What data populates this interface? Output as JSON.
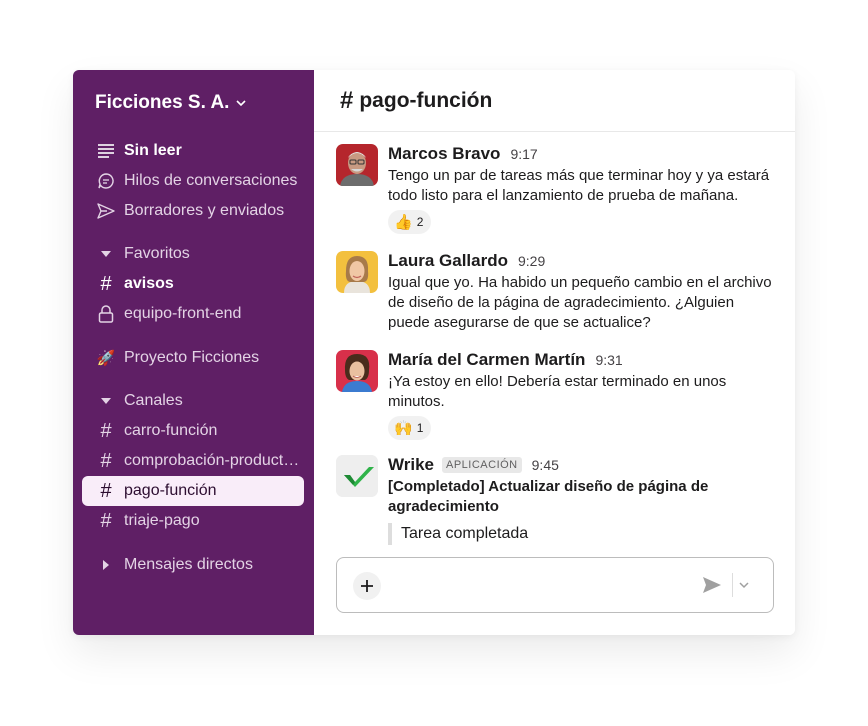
{
  "workspace": {
    "name": "Ficciones S. A."
  },
  "sidebar": {
    "top_items": [
      {
        "label": "Sin leer",
        "icon": "unread-icon"
      },
      {
        "label": "Hilos de conversaciones",
        "icon": "threads-icon"
      },
      {
        "label": "Borradores y enviados",
        "icon": "send-icon"
      }
    ],
    "favorites_section": "Favoritos",
    "favorites": [
      {
        "label": "avisos",
        "icon": "hash-icon"
      },
      {
        "label": "equipo-front-end",
        "icon": "lock-icon"
      }
    ],
    "project": {
      "label": "Proyecto Ficciones",
      "icon": "rocket-icon"
    },
    "channels_section": "Canales",
    "channels": [
      {
        "label": "carro-función"
      },
      {
        "label": "comprobación-product…"
      },
      {
        "label": "pago-función"
      },
      {
        "label": "triaje-pago"
      }
    ],
    "dms_section": "Mensajes directos"
  },
  "channel": {
    "hash": "#",
    "name": "pago-función"
  },
  "messages": [
    {
      "author": "Marcos Bravo",
      "time": "9:17",
      "text": "Tengo un par de tareas más que terminar hoy y ya estará todo listo para el lanzamiento de prueba de mañana.",
      "reaction": {
        "emoji": "👍",
        "count": "2"
      }
    },
    {
      "author": "Laura Gallardo",
      "time": "9:29",
      "text": "Igual que yo. Ha habido un pequeño cambio en el archivo de diseño de la página de agradecimiento. ¿Alguien puede asegurarse de que se actualice?"
    },
    {
      "author": "María del Carmen Martín",
      "time": "9:31",
      "text": "¡Ya estoy en ello! Debería estar terminado en unos minutos.",
      "reaction": {
        "emoji": "🙌",
        "count": "1"
      }
    },
    {
      "author": "Wrike",
      "badge": "APLICACIÓN",
      "time": "9:45",
      "text": "[Completado] Actualizar diseño de página de agradecimiento",
      "quote": "Tarea completada"
    }
  ],
  "colors": {
    "sidebar": "#5f1f65",
    "active_item": "#f9edf9",
    "check_green": "#2fb34a"
  }
}
